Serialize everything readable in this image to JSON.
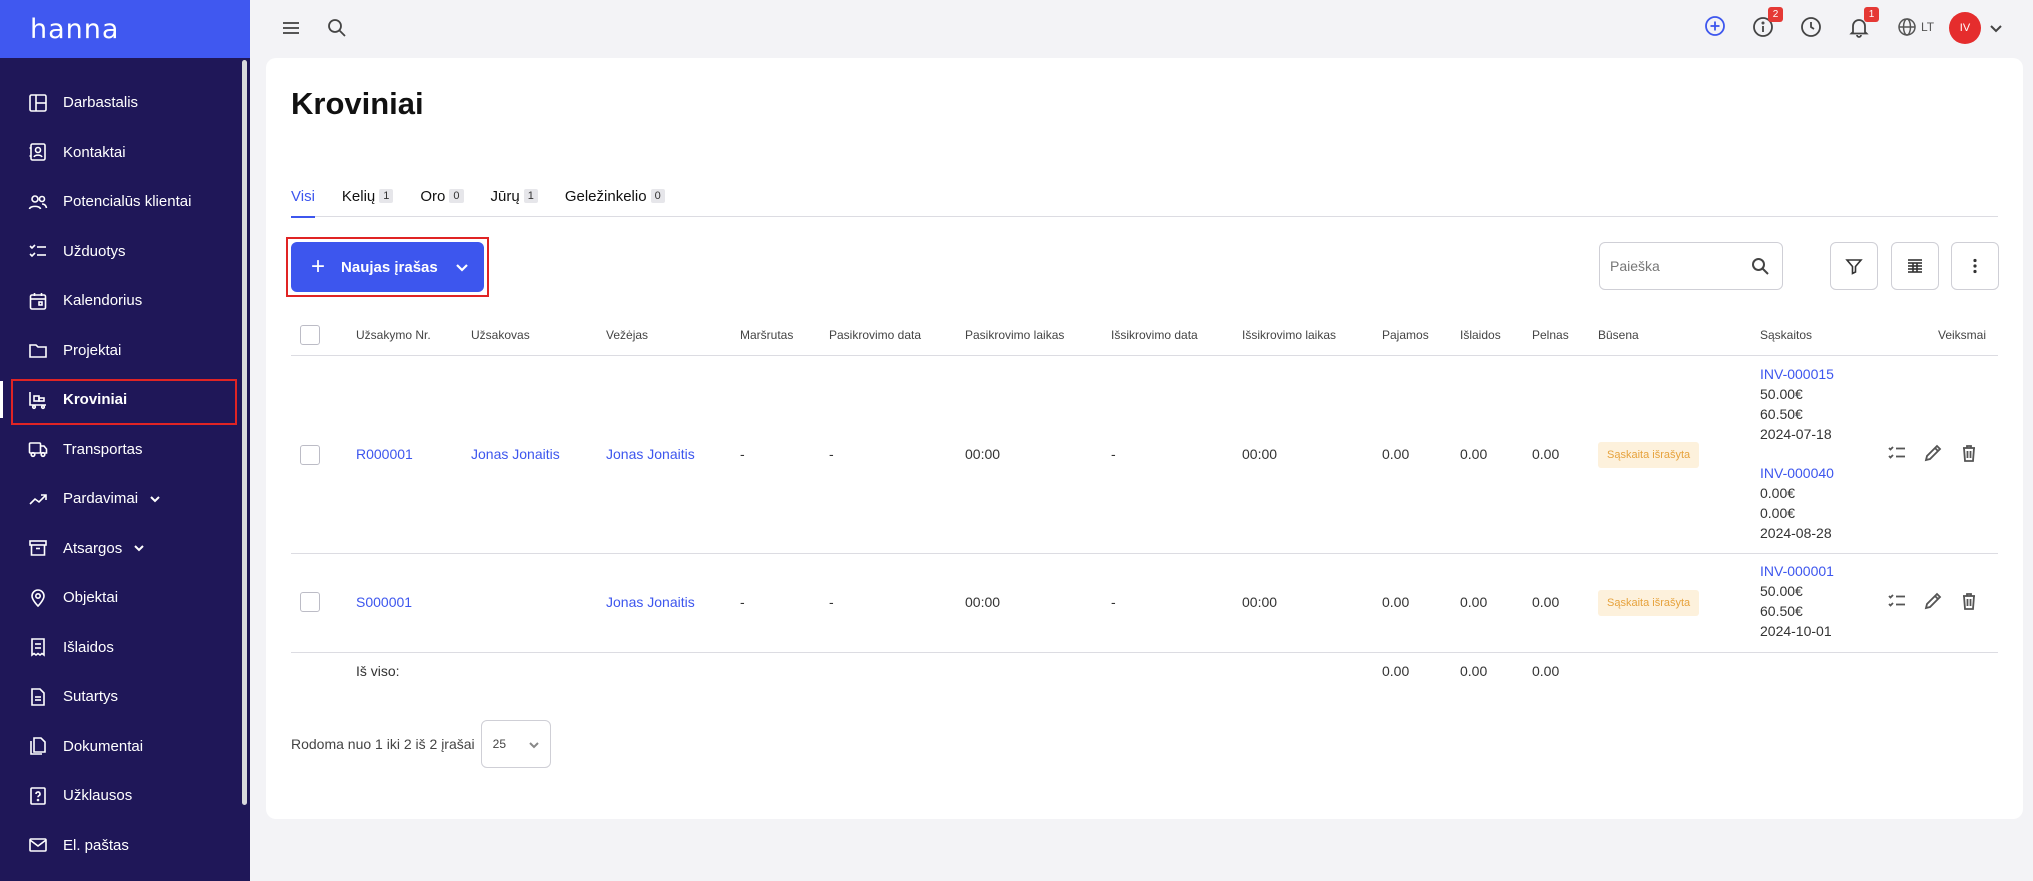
{
  "brand": "hanna",
  "sidebar": {
    "items": [
      {
        "label": "Darbastalis",
        "icon": "dashboard-icon"
      },
      {
        "label": "Kontaktai",
        "icon": "contacts-icon"
      },
      {
        "label": "Potencialūs klientai",
        "icon": "leads-icon"
      },
      {
        "label": "Užduotys",
        "icon": "tasks-icon"
      },
      {
        "label": "Kalendorius",
        "icon": "calendar-icon"
      },
      {
        "label": "Projektai",
        "icon": "folder-icon"
      },
      {
        "label": "Kroviniai",
        "icon": "cargo-icon"
      },
      {
        "label": "Transportas",
        "icon": "truck-icon"
      },
      {
        "label": "Pardavimai",
        "icon": "trend-icon"
      },
      {
        "label": "Atsargos",
        "icon": "archive-icon"
      },
      {
        "label": "Objektai",
        "icon": "location-pin-icon"
      },
      {
        "label": "Išlaidos",
        "icon": "receipt-icon"
      },
      {
        "label": "Sutartys",
        "icon": "contract-icon"
      },
      {
        "label": "Dokumentai",
        "icon": "documents-icon"
      },
      {
        "label": "Užklausos",
        "icon": "question-icon"
      },
      {
        "label": "El. paštas",
        "icon": "mail-icon"
      }
    ]
  },
  "topbar": {
    "info_badge": "2",
    "notif_badge": "1",
    "language": "LT",
    "avatar_initials": "IV"
  },
  "page": {
    "title": "Kroviniai",
    "tabs": [
      {
        "label": "Visi",
        "count": ""
      },
      {
        "label": "Kelių",
        "count": "1"
      },
      {
        "label": "Oro",
        "count": "0"
      },
      {
        "label": "Jūrų",
        "count": "1"
      },
      {
        "label": "Geležinkelio",
        "count": "0"
      }
    ],
    "new_button_label": "Naujas įrašas",
    "search_placeholder": "Paieška"
  },
  "table": {
    "headers": [
      "Užsakymo Nr.",
      "Užsakovas",
      "Vežėjas",
      "Maršrutas",
      "Pasikrovimo data",
      "Pasikrovimo laikas",
      "Išsikrovimo data",
      "Išsikrovimo laikas",
      "Pajamos",
      "Išlaidos",
      "Pelnas",
      "Būsena",
      "Sąskaitos",
      "Veiksmai"
    ],
    "rows": [
      {
        "order": "R000001",
        "customer": "Jonas Jonaitis",
        "carrier": "Jonas Jonaitis",
        "route": "-",
        "load_date": "-",
        "load_time": "00:00",
        "unload_date": "-",
        "unload_time": "00:00",
        "income": "0.00",
        "expenses": "0.00",
        "profit": "0.00",
        "status": "Sąskaita išrašyta",
        "invoices": [
          {
            "number": "INV-000015",
            "amount": "50.00€",
            "total": "60.50€",
            "date": "2024-07-18"
          },
          {
            "number": "INV-000040",
            "amount": "0.00€",
            "total": "0.00€",
            "date": "2024-08-28"
          }
        ]
      },
      {
        "order": "S000001",
        "customer": "",
        "carrier": "Jonas Jonaitis",
        "route": "-",
        "load_date": "-",
        "load_time": "00:00",
        "unload_date": "-",
        "unload_time": "00:00",
        "income": "0.00",
        "expenses": "0.00",
        "profit": "0.00",
        "status": "Sąskaita išrašyta",
        "invoices": [
          {
            "number": "INV-000001",
            "amount": "50.00€",
            "total": "60.50€",
            "date": "2024-10-01"
          }
        ]
      }
    ],
    "footer": {
      "label": "Iš viso:",
      "income": "0.00",
      "expenses": "0.00",
      "profit": "0.00"
    }
  },
  "pagination": {
    "summary": "Rodoma nuo 1 iki 2 iš 2 įrašai",
    "per_page": "25"
  },
  "colors": {
    "accent": "#3d56ee",
    "sidebar": "#1f1758",
    "brand_bar": "#4058f0",
    "status_bg": "#fdf1dc",
    "status_text": "#e6a23c",
    "highlight": "#e02424"
  }
}
